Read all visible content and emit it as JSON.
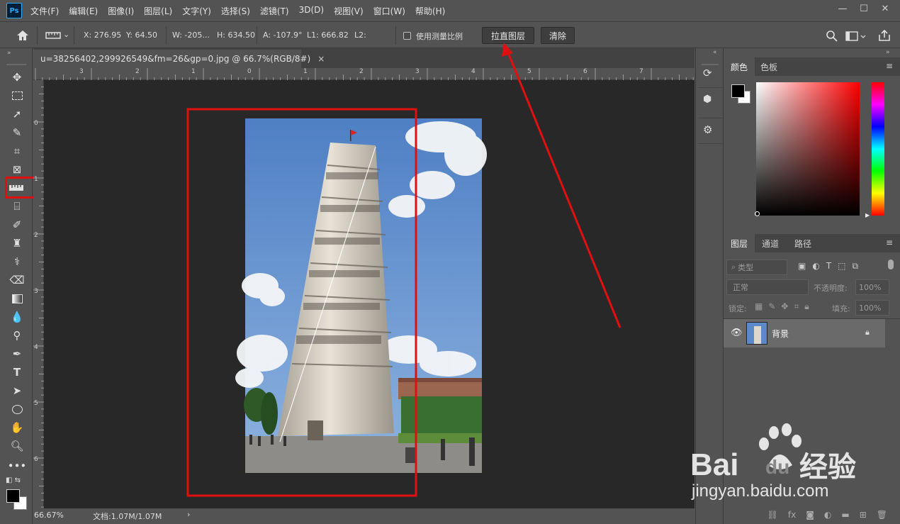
{
  "app": {
    "logo": "Ps"
  },
  "menu": [
    "文件(F)",
    "编辑(E)",
    "图像(I)",
    "图层(L)",
    "文字(Y)",
    "选择(S)",
    "滤镜(T)",
    "3D(D)",
    "视图(V)",
    "窗口(W)",
    "帮助(H)"
  ],
  "window_controls": {
    "minimize": "—",
    "maximize": "☐",
    "close": "✕"
  },
  "options": {
    "x": "X: 276.95",
    "y": "Y: 64.50",
    "w": "W: -205...",
    "h": "H: 634.50",
    "a": "A: -107.9°",
    "l1": "L1: 666.82",
    "l2": "L2:",
    "measure_scale_label": "使用测量比例",
    "straighten_label": "拉直图层",
    "clear_label": "清除"
  },
  "document": {
    "tab_title": "u=38256402,299926549&fm=26&gp=0.jpg @ 66.7%(RGB/8#)",
    "tab_close": "×",
    "ruler_h_ticks": [
      "3",
      "2",
      "1",
      "0",
      "1",
      "2",
      "3",
      "4",
      "5",
      "6",
      "7"
    ],
    "ruler_v_ticks": [
      "0",
      "1",
      "2",
      "3",
      "4",
      "5",
      "6"
    ]
  },
  "status": {
    "zoom": "66.67%",
    "doc_info": "文档:1.07M/1.07M",
    "arrow": "›"
  },
  "color_panel": {
    "tabs": [
      "颜色",
      "色板"
    ],
    "fg_color": "#000000",
    "bg_color": "#ffffff",
    "hue_color": "#ff0000"
  },
  "layers_panel": {
    "tabs": [
      "图层",
      "通道",
      "路径"
    ],
    "filter_placeholder": "类型",
    "blend_mode": "正常",
    "opacity_label": "不透明度:",
    "opacity_value": "100%",
    "lock_label": "锁定:",
    "fill_label": "填充:",
    "fill_value": "100%",
    "layers": [
      {
        "name": "背景",
        "locked": true,
        "visible": true
      }
    ]
  },
  "annotations": {
    "highlight_color": "#e01010"
  },
  "watermark": {
    "brand_latin": "Bai",
    "brand_du": "du",
    "brand_cn": "经验",
    "url": "jingyan.baidu.com"
  }
}
